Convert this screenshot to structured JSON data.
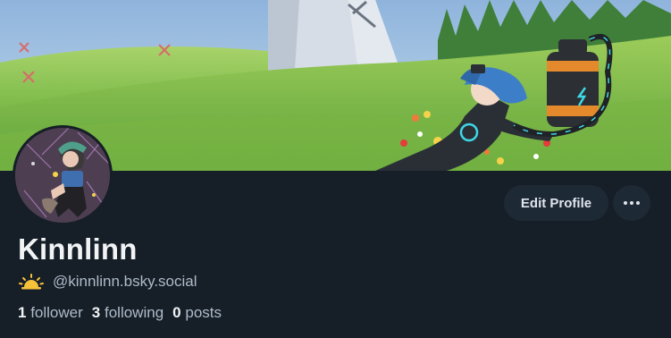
{
  "profile": {
    "display_name": "Kinnlinn",
    "handle": "@kinnlinn.bsky.social",
    "handle_icon": "sunrise-emoji-icon",
    "followers_count": "1",
    "followers_label": "follower",
    "following_count": "3",
    "following_label": "following",
    "posts_count": "0",
    "posts_label": "posts"
  },
  "actions": {
    "edit_label": "Edit Profile",
    "more_icon": "ellipsis-icon"
  },
  "colors": {
    "background": "#161e27",
    "button_bg": "#1e2936",
    "text_primary": "#f1f3f5",
    "text_secondary": "#aebbc9"
  }
}
